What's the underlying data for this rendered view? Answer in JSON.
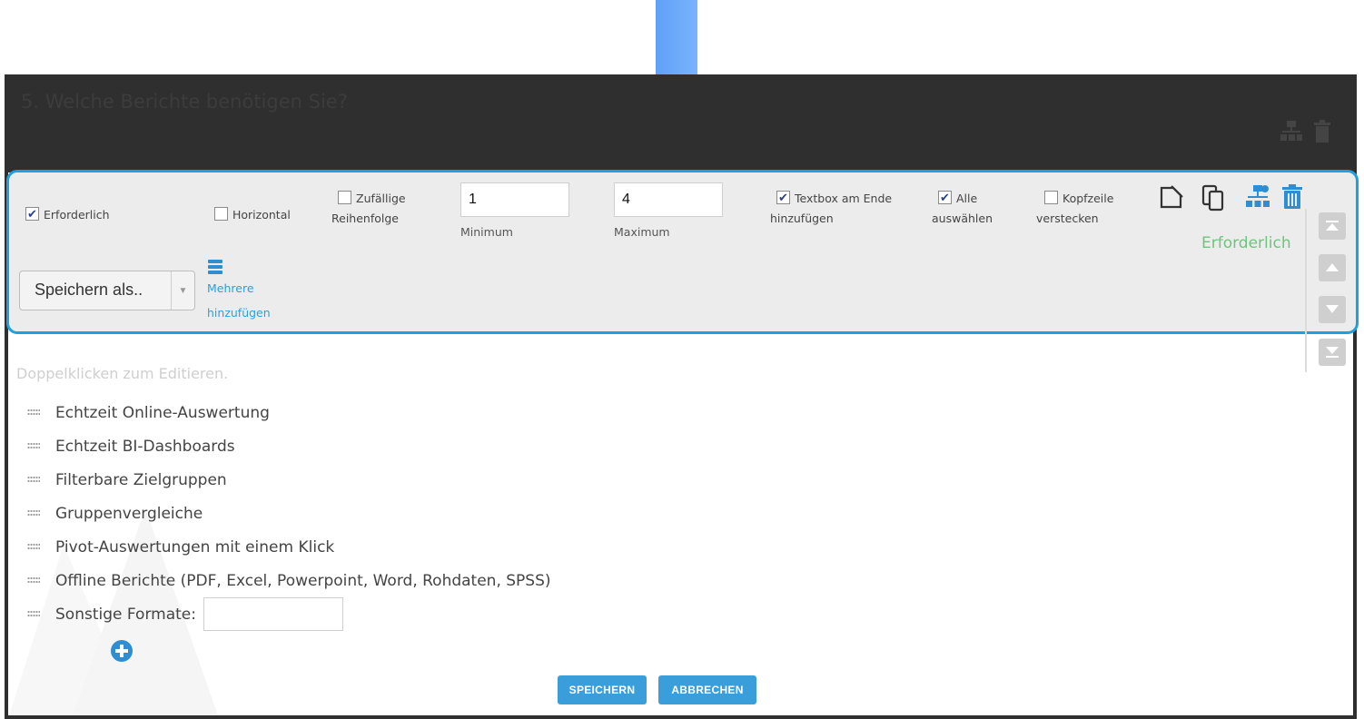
{
  "question": {
    "title": "5. Welche Berichte benötigen Sie?"
  },
  "toolbar": {
    "required": {
      "label": "Erforderlich",
      "checked": true
    },
    "horizontal": {
      "label": "Horizontal",
      "checked": false
    },
    "random": {
      "label_line1": "Zufällige",
      "label_line2": "Reihenfolge",
      "checked": false
    },
    "minimum": {
      "value": "1",
      "label": "Minimum"
    },
    "maximum": {
      "value": "4",
      "label": "Maximum"
    },
    "textbox_end": {
      "label_line1": "Textbox am Ende",
      "label_line2": "hinzufügen",
      "checked": true
    },
    "select_all": {
      "label_line1": "Alle",
      "label_line2": "auswählen",
      "checked": true
    },
    "hide_header": {
      "label_line1": "Kopfzeile",
      "label_line2": "verstecken",
      "checked": false
    },
    "required_status": "Erforderlich",
    "save_as": "Speichern als..",
    "add_multiple_line1": "Mehrere",
    "add_multiple_line2": "hinzufügen",
    "icons": [
      "edit-icon",
      "copy-icon",
      "sitemap-icon",
      "trash-icon"
    ]
  },
  "hint": "Doppelklicken zum Editieren.",
  "options": [
    "Echtzeit Online-Auswertung",
    "Echtzeit BI-Dashboards",
    "Filterbare Zielgruppen",
    "Gruppenvergleiche",
    "Pivot-Auswertungen mit einem Klick",
    "Offline Berichte (PDF, Excel, Powerpoint, Word, Rohdaten, SPSS)"
  ],
  "other_option": "Sonstige Formate:",
  "buttons": {
    "save": "SPEICHERN",
    "cancel": "ABBRECHEN"
  },
  "colors": {
    "accent": "#3a9edb",
    "toolbar_outline": "#1ea0e0",
    "required_green": "#70c37e",
    "header_dark": "#2f2f2f"
  }
}
